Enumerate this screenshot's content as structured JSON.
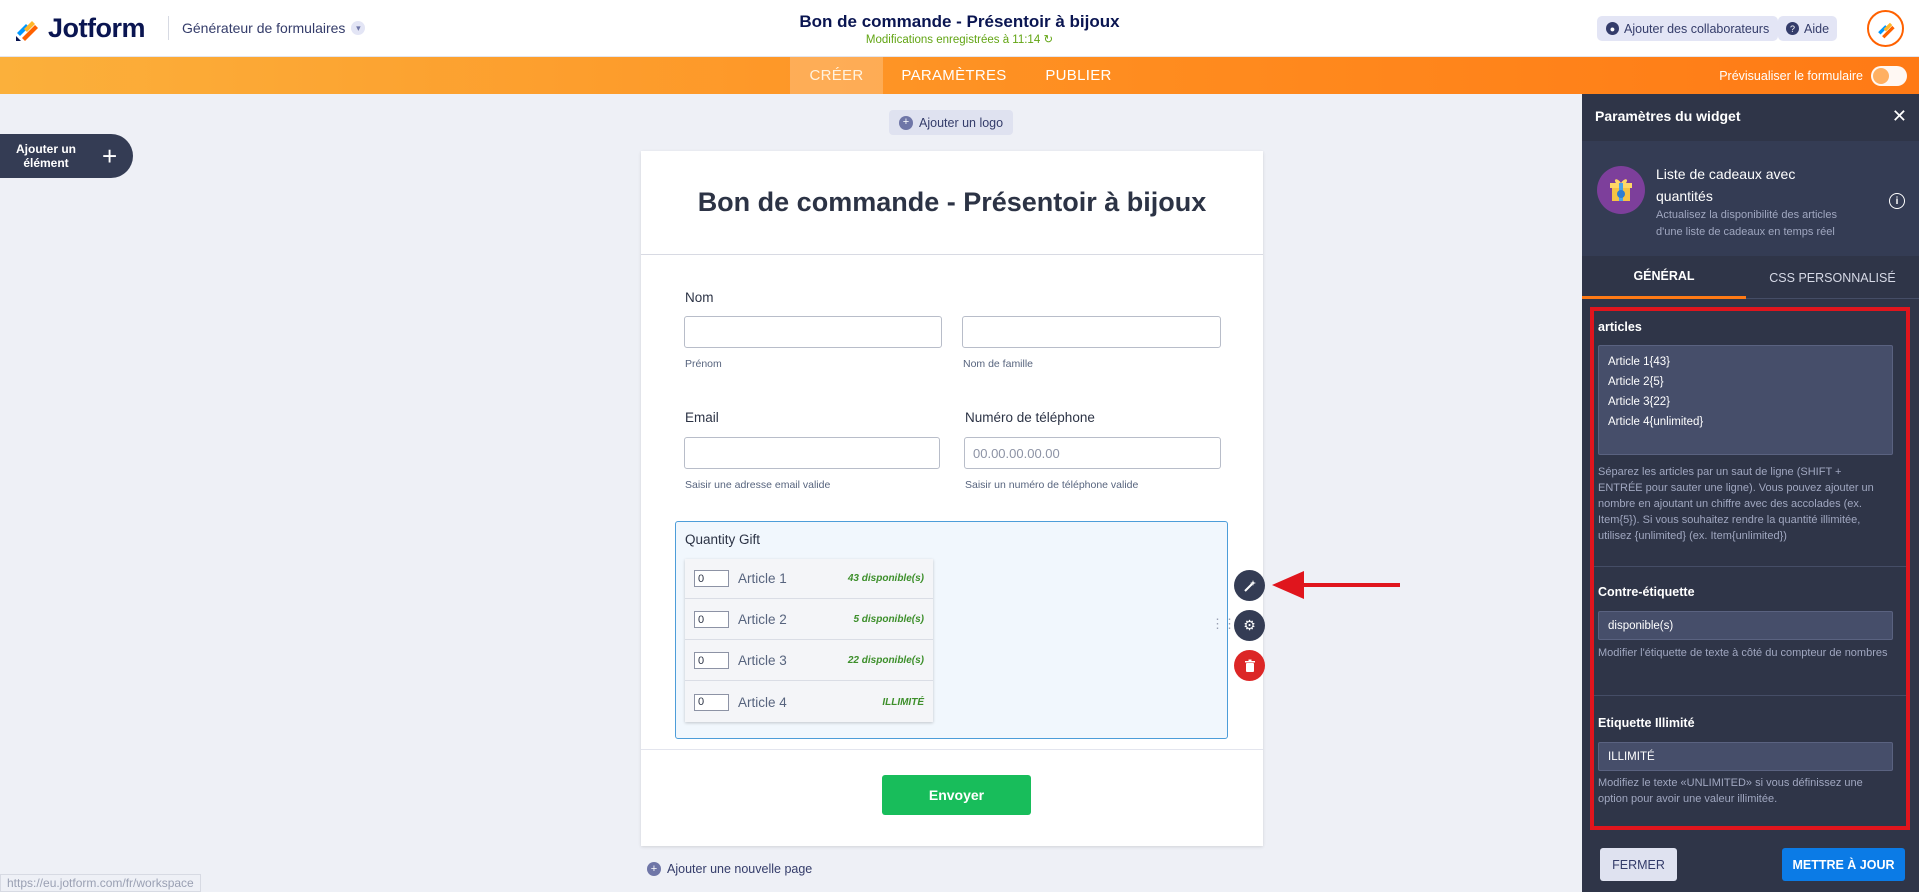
{
  "topbar": {
    "logo_text": "Jotform",
    "builder_label": "Générateur de formulaires",
    "doc_title": "Bon de commande - Présentoir à bijoux",
    "saved_status": "Modifications enregistrées à 11:14",
    "collab_label": "Ajouter des collaborateurs",
    "help_label": "Aide"
  },
  "nav": {
    "tabs": [
      "CRÉER",
      "PARAMÈTRES",
      "PUBLIER"
    ],
    "active_tab": "CRÉER",
    "preview_label": "Prévisualiser le formulaire"
  },
  "left": {
    "add_element_label": "Ajouter un élément",
    "add_logo_label": "Ajouter un logo",
    "add_page_label": "Ajouter une nouvelle page",
    "status_url": "https://eu.jotform.com/fr/workspace"
  },
  "form": {
    "title": "Bon de commande - Présentoir à bijoux",
    "name_label": "Nom",
    "first_name_sub": "Prénom",
    "last_name_sub": "Nom de famille",
    "email_label": "Email",
    "email_sub": "Saisir une adresse email valide",
    "phone_label": "Numéro de téléphone",
    "phone_placeholder": "00.00.00.00.00",
    "phone_sub": "Saisir un numéro de téléphone valide",
    "widget_title": "Quantity Gift",
    "gift_items": [
      {
        "qty": "0",
        "name": "Article 1",
        "avail": "43 disponible(s)"
      },
      {
        "qty": "0",
        "name": "Article 2",
        "avail": "5 disponible(s)"
      },
      {
        "qty": "0",
        "name": "Article 3",
        "avail": "22 disponible(s)"
      },
      {
        "qty": "0",
        "name": "Article 4",
        "avail": "ILLIMITÉ"
      }
    ],
    "submit_label": "Envoyer"
  },
  "panel": {
    "header": "Paramètres du widget",
    "widget_name": "Liste de cadeaux avec quantités",
    "widget_desc": "Actualisez la disponibilité des articles d'une liste de cadeaux en temps réel",
    "tabs": [
      "GÉNÉRAL",
      "CSS PERSONNALISÉ"
    ],
    "articles_label": "articles",
    "articles_lines": [
      "Article 1{43}",
      "Article 2{5}",
      "Article 3{22}",
      "Article 4{unlimited}"
    ],
    "articles_help": "Séparez les articles par un saut de ligne (SHIFT + ENTRÉE pour sauter une ligne). Vous pouvez ajouter un nombre en ajoutant un chiffre avec des accolades (ex. Item{5}). Si vous souhaitez rendre la quantité illimitée, utilisez {unlimited} (ex. Item{unlimited})",
    "counter_label": "Contre-étiquette",
    "counter_value": "disponible(s)",
    "counter_help": "Modifier l'étiquette de texte à côté du compteur de nombres",
    "unlimited_label": "Etiquette Illimité",
    "unlimited_value": "ILLIMITÉ",
    "unlimited_help": "Modifiez le texte «UNLIMITED» si vous définissez une option pour avoir une valeur illimitée.",
    "close_label": "FERMER",
    "update_label": "METTRE À JOUR"
  },
  "colors": {
    "brand_orange": "#ff7a15",
    "panel_bg": "#2f3548",
    "submit_green": "#18bd5b",
    "highlight_red": "#e0151d",
    "update_blue": "#0b7be6"
  }
}
